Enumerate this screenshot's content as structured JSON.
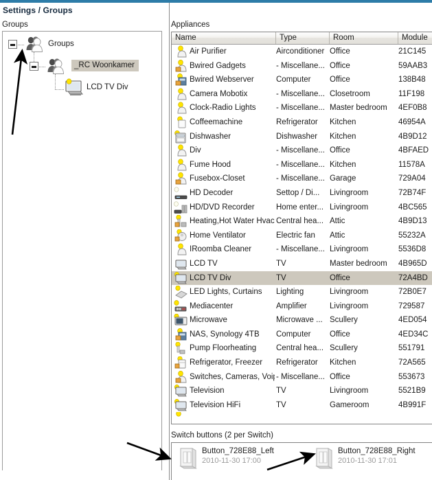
{
  "window": {
    "title": "Settings / Groups",
    "accent_color": "#2d7ca8",
    "selection_color": "#cdc8bd"
  },
  "groups_panel": {
    "label": "Groups",
    "tree": [
      {
        "label": "Groups",
        "icon": "group-icon",
        "expander": "minus",
        "depth": 0,
        "selected": false
      },
      {
        "label": "_RC Woonkamer",
        "icon": "group-icon",
        "expander": "minus",
        "depth": 1,
        "selected": true
      },
      {
        "label": "LCD TV Div",
        "icon": "tv-icon",
        "expander": "none",
        "depth": 2,
        "selected": false
      }
    ]
  },
  "appliances_panel": {
    "label": "Appliances",
    "columns": [
      "Name",
      "Type",
      "Room",
      "Module"
    ],
    "rows": [
      {
        "name": "Air Purifier",
        "type": "Airconditioner",
        "room": "Office",
        "module": "21C145",
        "icon": "bulb-device-icon",
        "selected": false
      },
      {
        "name": "Bwired Gadgets",
        "type": "- Miscellane...",
        "room": "Office",
        "module": "59AAB3",
        "icon": "bulb-lock-device-icon",
        "selected": false
      },
      {
        "name": "Bwired Webserver",
        "type": "Computer",
        "room": "Office",
        "module": "138B48",
        "icon": "bulb-lock-server-icon",
        "selected": false
      },
      {
        "name": "Camera Mobotix",
        "type": "- Miscellane...",
        "room": "Closetroom",
        "module": "11F198",
        "icon": "bulb-device-icon",
        "selected": false
      },
      {
        "name": "Clock-Radio Lights",
        "type": "- Miscellane...",
        "room": "Master bedroom",
        "module": "4EF0B8",
        "icon": "bulb-device-icon",
        "selected": false
      },
      {
        "name": "Coffeemachine",
        "type": "Refrigerator",
        "room": "Kitchen",
        "module": "46954A",
        "icon": "bulb-appliance-icon",
        "selected": false
      },
      {
        "name": "Dishwasher",
        "type": "Dishwasher",
        "room": "Kitchen",
        "module": "4B9D12",
        "icon": "dishwasher-icon",
        "selected": false
      },
      {
        "name": "Div",
        "type": "- Miscellane...",
        "room": "Office",
        "module": "4BFAED",
        "icon": "bulb-device-icon",
        "selected": false
      },
      {
        "name": "Fume Hood",
        "type": "- Miscellane...",
        "room": "Kitchen",
        "module": "11578A",
        "icon": "bulb-device-icon",
        "selected": false
      },
      {
        "name": "Fusebox-Closet",
        "type": "- Miscellane...",
        "room": "Garage",
        "module": "729A04",
        "icon": "bulb-lock-device-icon",
        "selected": false
      },
      {
        "name": "HD Decoder",
        "type": "Settop / Di...",
        "room": "Livingroom",
        "module": "72B74F",
        "icon": "settop-icon",
        "selected": false
      },
      {
        "name": "HD/DVD Recorder",
        "type": "Home enter...",
        "room": "Livingroom",
        "module": "4BC565",
        "icon": "recorder-icon",
        "selected": false
      },
      {
        "name": "Heating,Hot Water Hvac",
        "type": "Central hea...",
        "room": "Attic",
        "module": "4B9D13",
        "icon": "bulb-lock-heating-icon",
        "selected": false
      },
      {
        "name": "Home Ventilator",
        "type": "Electric fan",
        "room": "Attic",
        "module": "55232A",
        "icon": "bulb-lock-fan-icon",
        "selected": false
      },
      {
        "name": "IRoomba Cleaner",
        "type": "- Miscellane...",
        "room": "Livingroom",
        "module": "5536D8",
        "icon": "bulb-device-icon",
        "selected": false
      },
      {
        "name": "LCD TV",
        "type": "TV",
        "room": "Master bedroom",
        "module": "4B965D",
        "icon": "tv-icon",
        "selected": false
      },
      {
        "name": "LCD TV Div",
        "type": "TV",
        "room": "Office",
        "module": "72A4BD",
        "icon": "tv-bulb-icon",
        "selected": true
      },
      {
        "name": "LED Lights, Curtains",
        "type": "Lighting",
        "room": "Livingroom",
        "module": "72B0E7",
        "icon": "bulb-lighting-icon",
        "selected": false
      },
      {
        "name": "Mediacenter",
        "type": "Amplifier",
        "room": "Livingroom",
        "module": "729587",
        "icon": "amplifier-icon",
        "selected": false
      },
      {
        "name": "Microwave",
        "type": "Microwave ...",
        "room": "Scullery",
        "module": "4ED054",
        "icon": "microwave-icon",
        "selected": false
      },
      {
        "name": "NAS, Synology 4TB",
        "type": "Computer",
        "room": "Office",
        "module": "4ED34C",
        "icon": "bulb-lock-server-icon",
        "selected": false
      },
      {
        "name": "Pump Floorheating",
        "type": "Central hea...",
        "room": "Scullery",
        "module": "551791",
        "icon": "bulb-pump-icon",
        "selected": false
      },
      {
        "name": "Refrigerator, Freezer",
        "type": "Refrigerator",
        "room": "Kitchen",
        "module": "72A565",
        "icon": "bulb-lock-fridge-icon",
        "selected": false
      },
      {
        "name": "Switches, Cameras, Voip",
        "type": "- Miscellane...",
        "room": "Office",
        "module": "553673",
        "icon": "bulb-lock-device-icon",
        "selected": false
      },
      {
        "name": "Television",
        "type": "TV",
        "room": "Livingroom",
        "module": "5521B9",
        "icon": "tv-bulb-icon",
        "selected": false
      },
      {
        "name": "Television HiFi",
        "type": "TV",
        "room": "Gameroom",
        "module": "4B991F",
        "icon": "tv-bulb-icon",
        "selected": false
      }
    ]
  },
  "switch_panel": {
    "label": "Switch buttons (2 per Switch)",
    "buttons": [
      {
        "title": "Button_728E88_Left",
        "date": "2010-11-30 17:00",
        "icon": "switch-icon"
      },
      {
        "title": "Button_728E88_Right",
        "date": "2010-11-30 17:01",
        "icon": "switch-icon"
      }
    ]
  },
  "annotations": [
    {
      "name": "arrow-to-group-expander"
    },
    {
      "name": "arrow-to-switch-left"
    },
    {
      "name": "arrow-to-switch-right"
    }
  ]
}
